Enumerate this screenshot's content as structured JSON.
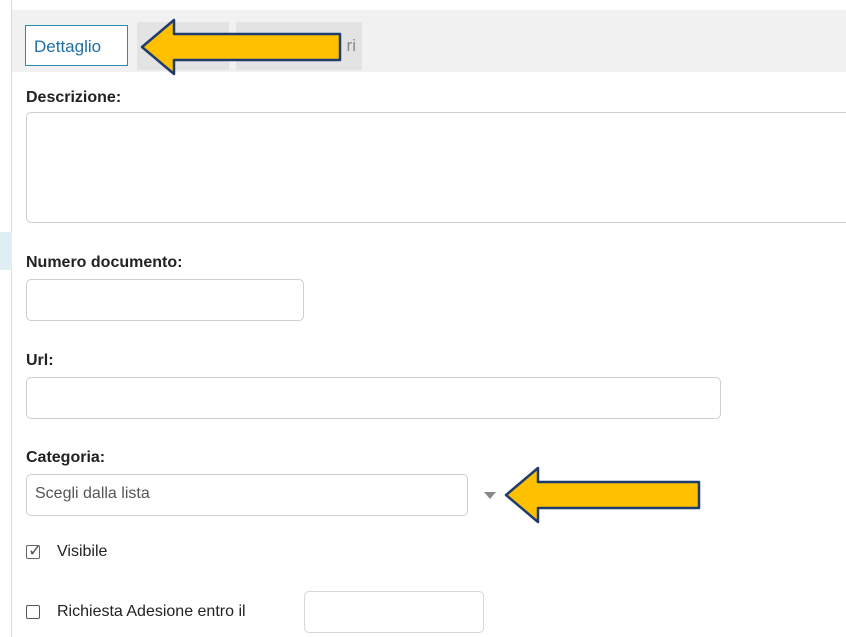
{
  "tabs": [
    {
      "label": "Dettaglio",
      "active": true
    },
    {
      "label": "",
      "active": false
    },
    {
      "label": "ri",
      "active": false
    }
  ],
  "form": {
    "descrizione_label": "Descrizione:",
    "numero_documento_label": "Numero documento:",
    "url_label": "Url:",
    "categoria_label": "Categoria:",
    "categoria_placeholder": "Scegli dalla lista",
    "visibile_label": "Visibile",
    "visibile_checked": true,
    "richiesta_label": "Richiesta Adesione entro il",
    "richiesta_checked": false
  },
  "colors": {
    "annotation_arrow_fill": "#FFC000",
    "annotation_arrow_stroke": "#1F3C6E",
    "active_tab_border": "#2A8AB0"
  }
}
